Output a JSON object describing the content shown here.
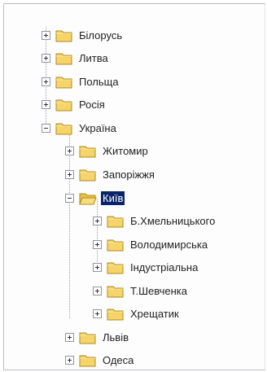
{
  "tree": {
    "items": [
      {
        "label": "Білорусь",
        "expander": "plus",
        "folder": "closed"
      },
      {
        "label": "Литва",
        "expander": "plus",
        "folder": "closed"
      },
      {
        "label": "Польща",
        "expander": "plus",
        "folder": "closed"
      },
      {
        "label": "Росія",
        "expander": "plus",
        "folder": "closed"
      },
      {
        "label": "Україна",
        "expander": "minus",
        "folder": "closed",
        "children": [
          {
            "label": "Житомир",
            "expander": "plus",
            "folder": "closed"
          },
          {
            "label": "Запоріжжя",
            "expander": "plus",
            "folder": "closed"
          },
          {
            "label": "Київ",
            "expander": "minus",
            "folder": "open",
            "selected": true,
            "children": [
              {
                "label": "Б.Хмельницького",
                "expander": "plus",
                "folder": "closed"
              },
              {
                "label": "Володимирська",
                "expander": "plus",
                "folder": "closed"
              },
              {
                "label": "Індустріальна",
                "expander": "plus",
                "folder": "closed"
              },
              {
                "label": "Т.Шевченка",
                "expander": "plus",
                "folder": "closed"
              },
              {
                "label": "Хрещатик",
                "expander": "plus",
                "folder": "closed"
              }
            ]
          },
          {
            "label": "Львів",
            "expander": "plus",
            "folder": "closed"
          },
          {
            "label": "Одеса",
            "expander": "plus",
            "folder": "closed"
          }
        ]
      }
    ]
  },
  "colors": {
    "folder_fill": "#f5d46a",
    "folder_stroke": "#b08a1e",
    "selection": "#0a246a"
  }
}
